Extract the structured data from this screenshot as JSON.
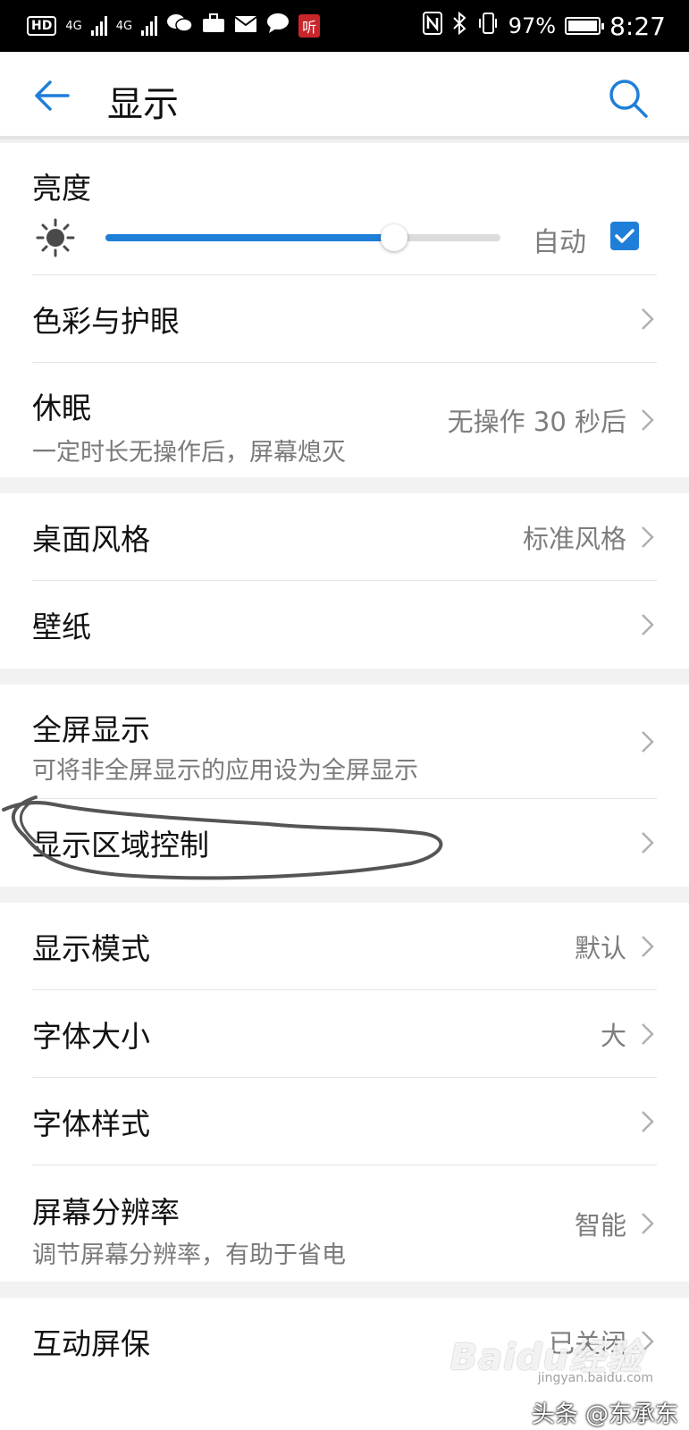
{
  "status_bar": {
    "hd": "HD",
    "net1": "4G",
    "net2": "4G",
    "red_app": "听",
    "battery": "97%",
    "time": "8:27"
  },
  "header": {
    "title": "显示"
  },
  "brightness": {
    "label": "亮度",
    "level": 0.73,
    "auto_label": "自动",
    "auto_checked": true
  },
  "rows": {
    "color_eye": {
      "label": "色彩与护眼"
    },
    "sleep": {
      "label": "休眠",
      "sub": "一定时长无操作后，屏幕熄灭",
      "value": "无操作 30 秒后"
    },
    "desktop_style": {
      "label": "桌面风格",
      "value": "标准风格"
    },
    "wallpaper": {
      "label": "壁纸"
    },
    "full_screen": {
      "label": "全屏显示",
      "sub": "可将非全屏显示的应用设为全屏显示"
    },
    "display_area": {
      "label": "显示区域控制"
    },
    "display_mode": {
      "label": "显示模式",
      "value": "默认"
    },
    "font_size": {
      "label": "字体大小",
      "value": "大"
    },
    "font_style": {
      "label": "字体样式"
    },
    "resolution": {
      "label": "屏幕分辨率",
      "sub": "调节屏幕分辨率，有助于省电",
      "value": "智能"
    },
    "screensaver": {
      "label": "互动屏保",
      "value": "已关闭"
    }
  },
  "overlay": {
    "watermark": "Baidu经验",
    "watermark_sub": "jingyan.baidu.com",
    "credit": "头条 @东承东"
  },
  "colors": {
    "accent": "#1f7fd8",
    "annotation": "#555555"
  }
}
